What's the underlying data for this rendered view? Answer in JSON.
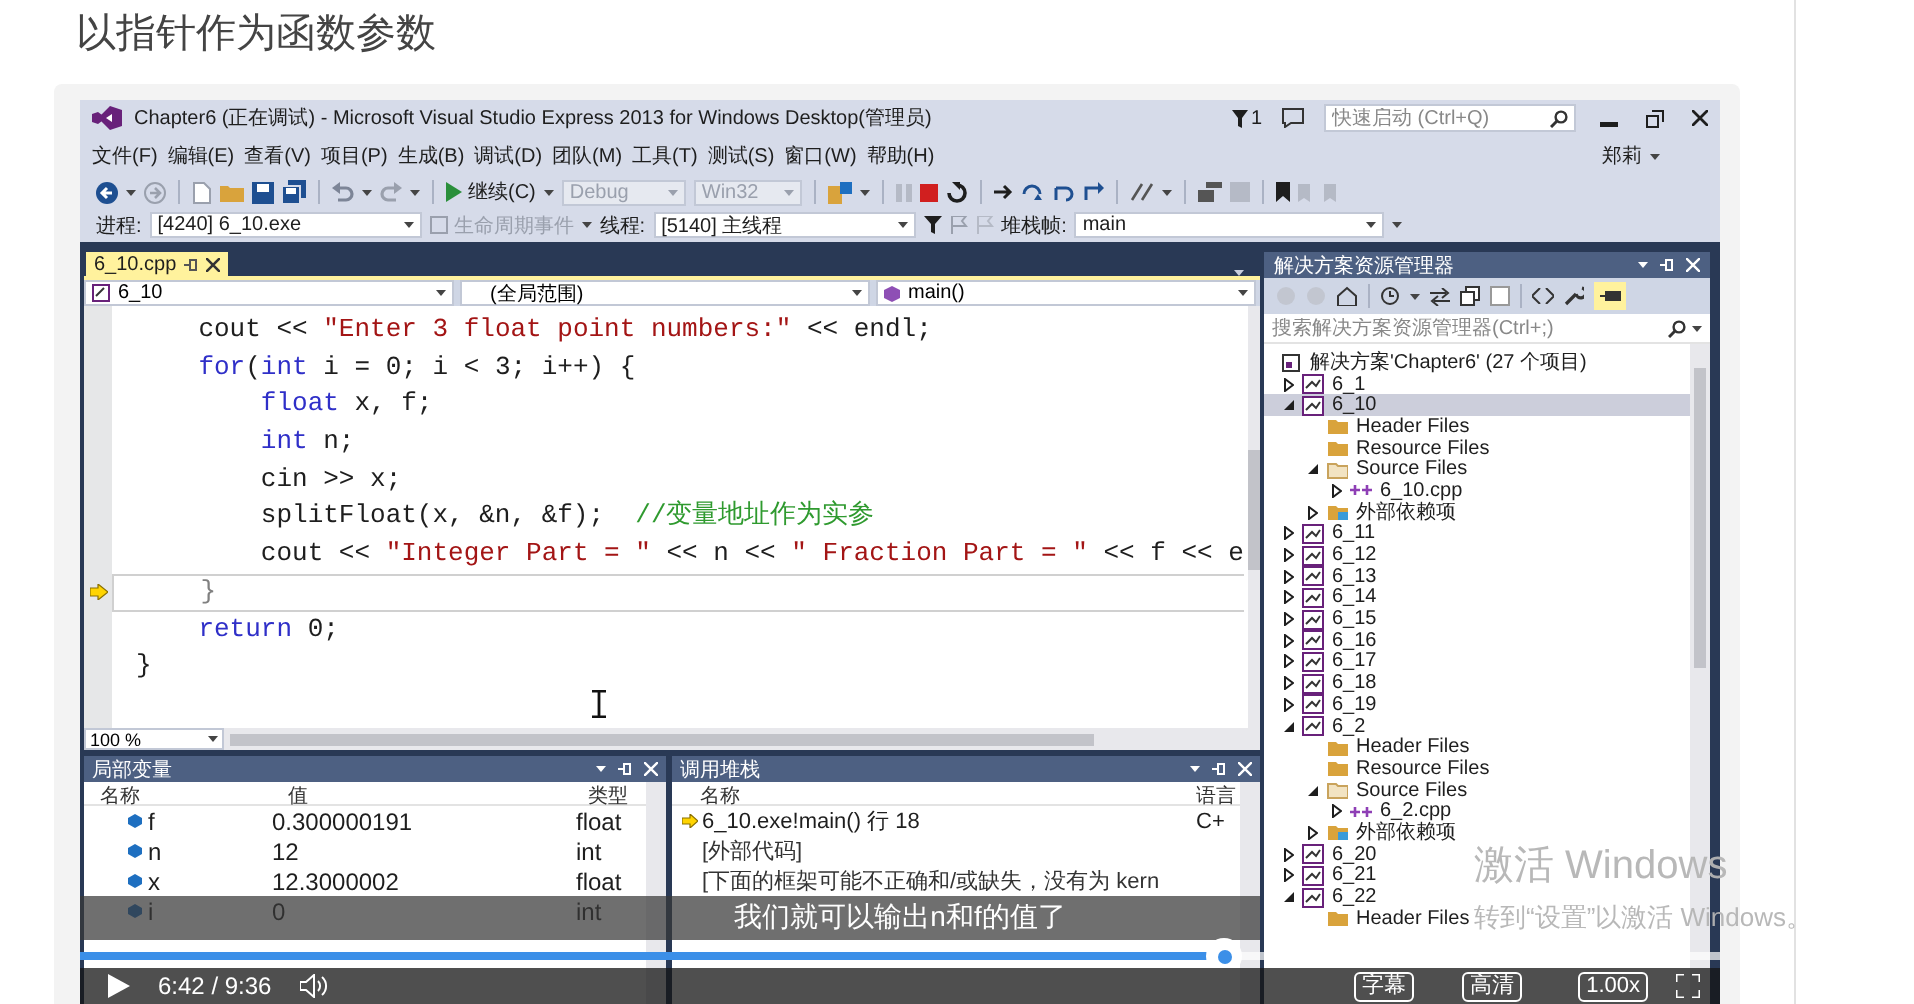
{
  "page_title": "以指针作为函数参数",
  "window": {
    "title": "Chapter6 (正在调试) - Microsoft Visual Studio Express 2013 for Windows Desktop(管理员)",
    "notification_count": "1",
    "quick_launch": {
      "placeholder": "快速启动 (Ctrl+Q)"
    },
    "user": "郑莉"
  },
  "menu": [
    "文件(F)",
    "编辑(E)",
    "查看(V)",
    "项目(P)",
    "生成(B)",
    "调试(D)",
    "团队(M)",
    "工具(T)",
    "测试(S)",
    "窗口(W)",
    "帮助(H)"
  ],
  "toolbar": {
    "continue": "继续(C)",
    "configuration": {
      "value": "Debug",
      "disabled": true
    },
    "platform": {
      "value": "Win32",
      "disabled": true
    }
  },
  "debug_location": {
    "process_label": "进程:",
    "process": "[4240] 6_10.exe",
    "lifecycle": {
      "label": "生命周期事件",
      "disabled": true
    },
    "thread_label": "线程:",
    "thread": "[5140] 主线程",
    "stack_frame_label": "堆栈帧:",
    "stack_frame": "main"
  },
  "editor": {
    "tabs": [
      {
        "label": "6_10.cpp",
        "selected": true
      }
    ],
    "project": "6_10",
    "scope": "(全局范围)",
    "function": "main()",
    "zoom": "100 %",
    "lines": [
      {
        "current": false,
        "tokens": [
          {
            "kind": "plain",
            "text": "    cout << "
          },
          {
            "kind": "string",
            "text": "\"Enter 3 float point numbers:\""
          },
          {
            "kind": "plain",
            "text": " << endl;"
          }
        ]
      },
      {
        "current": false,
        "tokens": [
          {
            "kind": "keyword",
            "text": "    for"
          },
          {
            "kind": "plain",
            "text": "("
          },
          {
            "kind": "keyword",
            "text": "int"
          },
          {
            "kind": "plain",
            "text": " i = 0; i < 3; i++) {"
          }
        ]
      },
      {
        "current": false,
        "tokens": [
          {
            "kind": "keyword",
            "text": "        float"
          },
          {
            "kind": "plain",
            "text": " x, f;"
          }
        ]
      },
      {
        "current": false,
        "tokens": [
          {
            "kind": "keyword",
            "text": "        int"
          },
          {
            "kind": "plain",
            "text": " n;"
          }
        ]
      },
      {
        "current": false,
        "tokens": [
          {
            "kind": "plain",
            "text": "        cin >> x;"
          }
        ]
      },
      {
        "current": false,
        "tokens": [
          {
            "kind": "plain",
            "text": "        splitFloat(x, &n, &f);  "
          },
          {
            "kind": "comment",
            "text": "//变量地址作为实参"
          }
        ]
      },
      {
        "current": false,
        "tokens": [
          {
            "kind": "plain",
            "text": "        cout << "
          },
          {
            "kind": "string",
            "text": "\"Integer Part = \""
          },
          {
            "kind": "plain",
            "text": " << n << "
          },
          {
            "kind": "string",
            "text": "\" Fraction Part = \""
          },
          {
            "kind": "plain",
            "text": " << f << e"
          }
        ]
      },
      {
        "current": true,
        "tokens": [
          {
            "kind": "plain",
            "text": "    }"
          }
        ]
      },
      {
        "current": false,
        "tokens": [
          {
            "kind": "keyword",
            "text": "    return"
          },
          {
            "kind": "plain",
            "text": " 0;"
          }
        ]
      },
      {
        "current": false,
        "tokens": [
          {
            "kind": "plain",
            "text": "}"
          }
        ]
      }
    ]
  },
  "locals": {
    "title": "局部变量",
    "columns": [
      "名称",
      "值",
      "类型"
    ],
    "rows": [
      {
        "name": "f",
        "value": "0.300000191",
        "type": "float"
      },
      {
        "name": "n",
        "value": "12",
        "type": "int"
      },
      {
        "name": "x",
        "value": "12.3000002",
        "type": "float"
      },
      {
        "name": "i",
        "value": "0",
        "type": "int"
      }
    ]
  },
  "callstack": {
    "title": "调用堆栈",
    "columns": [
      "名称",
      "语言"
    ],
    "rows": [
      {
        "name": "6_10.exe!main() 行 18",
        "language": "C+",
        "current": true
      },
      {
        "name": "[外部代码]",
        "current": false
      },
      {
        "name": "[下面的框架可能不正确和/或缺失，没有为 kern",
        "current": false
      }
    ]
  },
  "solution_explorer": {
    "title": "解决方案资源管理器",
    "search": {
      "placeholder": "搜索解决方案资源管理器(Ctrl+;)"
    },
    "tree": [
      {
        "kind": "solution",
        "label": "解决方案'Chapter6' (27 个项目)",
        "selected": false,
        "children": [
          {
            "kind": "project",
            "label": "6_1",
            "expanded": false,
            "selected": false
          },
          {
            "kind": "project",
            "label": "6_10",
            "expanded": true,
            "selected": true,
            "children": [
              {
                "kind": "folder",
                "label": "Header Files",
                "selected": false
              },
              {
                "kind": "folder",
                "label": "Resource Files",
                "selected": false
              },
              {
                "kind": "source_folder",
                "label": "Source Files",
                "expanded": true,
                "selected": false,
                "children": [
                  {
                    "kind": "cpp",
                    "label": "6_10.cpp",
                    "expanded": false,
                    "selected": false
                  }
                ]
              },
              {
                "kind": "dependencies",
                "label": "外部依赖项",
                "expanded": false,
                "selected": false
              }
            ]
          },
          {
            "kind": "project",
            "label": "6_11",
            "expanded": false,
            "selected": false
          },
          {
            "kind": "project",
            "label": "6_12",
            "expanded": false,
            "selected": false
          },
          {
            "kind": "project",
            "label": "6_13",
            "expanded": false,
            "selected": false
          },
          {
            "kind": "project",
            "label": "6_14",
            "expanded": false,
            "selected": false
          },
          {
            "kind": "project",
            "label": "6_15",
            "expanded": false,
            "selected": false
          },
          {
            "kind": "project",
            "label": "6_16",
            "expanded": false,
            "selected": false
          },
          {
            "kind": "project",
            "label": "6_17",
            "expanded": false,
            "selected": false
          },
          {
            "kind": "project",
            "label": "6_18",
            "expanded": false,
            "selected": false
          },
          {
            "kind": "project",
            "label": "6_19",
            "expanded": false,
            "selected": false
          },
          {
            "kind": "project",
            "label": "6_2",
            "expanded": true,
            "selected": false,
            "children": [
              {
                "kind": "folder",
                "label": "Header Files",
                "selected": false
              },
              {
                "kind": "folder",
                "label": "Resource Files",
                "selected": false
              },
              {
                "kind": "source_folder",
                "label": "Source Files",
                "expanded": true,
                "selected": false,
                "children": [
                  {
                    "kind": "cpp",
                    "label": "6_2.cpp",
                    "expanded": false,
                    "selected": false
                  }
                ]
              },
              {
                "kind": "dependencies",
                "label": "外部依赖项",
                "expanded": false,
                "selected": false
              }
            ]
          },
          {
            "kind": "project",
            "label": "6_20",
            "expanded": false,
            "selected": false
          },
          {
            "kind": "project",
            "label": "6_21",
            "expanded": false,
            "selected": false
          },
          {
            "kind": "project",
            "label": "6_22",
            "expanded": true,
            "selected": false,
            "children": [
              {
                "kind": "folder",
                "label": "Header Files",
                "selected": false
              }
            ]
          }
        ]
      }
    ]
  },
  "video": {
    "subtitle": "我们就可以输出n和f的值了",
    "progress": {
      "level": 0.698
    },
    "time": "6:42 / 9:36",
    "buttons": [
      {
        "kind": "subtitles",
        "label": "字幕"
      },
      {
        "kind": "quality",
        "label": "高清"
      },
      {
        "kind": "speed",
        "label": "1.00x"
      }
    ]
  },
  "activation_notice": {
    "title": "激活 Windows",
    "message": "转到“设置”以激活 Windows。"
  }
}
